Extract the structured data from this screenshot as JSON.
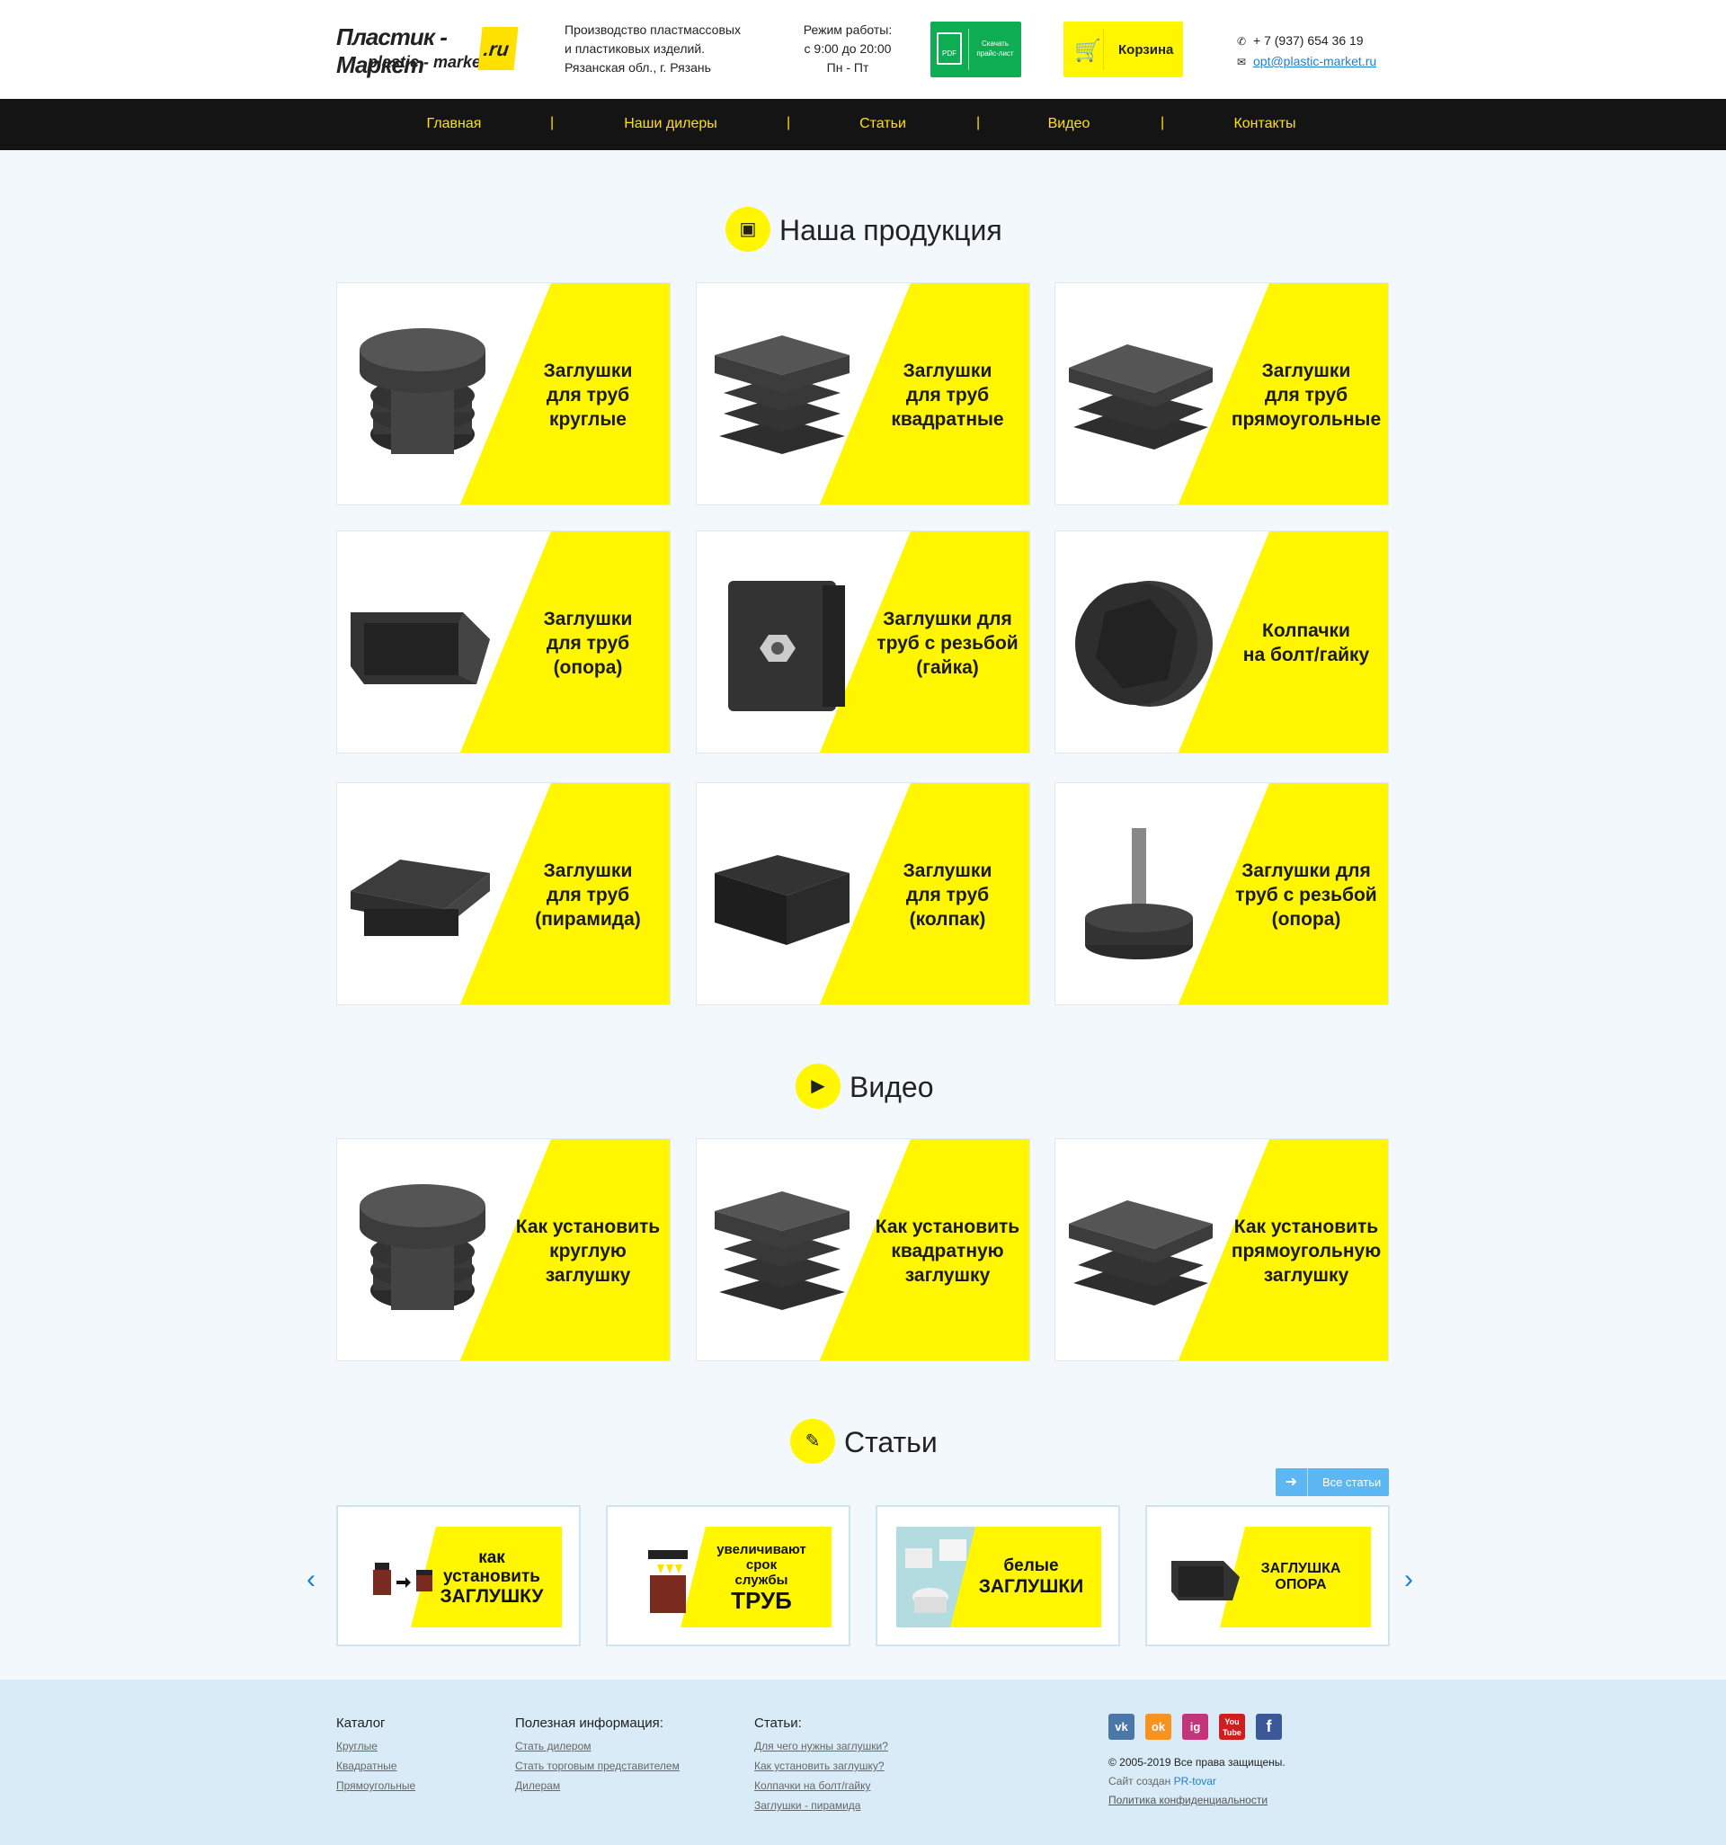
{
  "header": {
    "logo_line1": "Пластик - Маркет",
    "logo_line2": "plastic - market",
    "logo_ru": ".ru",
    "production": [
      "Производство пластмассовых",
      "и пластиковых изделий.",
      "Рязанская обл., г. Рязань"
    ],
    "hours": [
      "Режим работы:",
      "с 9:00 до 20:00",
      "Пн - Пт"
    ],
    "pdf_icon": "PDF",
    "pdf_button": [
      "Скачать",
      "прайс-лист"
    ],
    "cart_label": "Корзина",
    "phone": "+ 7 (937) 654 36 19",
    "email": "opt@plastic-market.ru"
  },
  "nav": [
    "Главная",
    "Наши дилеры",
    "Статьи",
    "Видео",
    "Контакты"
  ],
  "nav_separator": "|",
  "products": {
    "title": "Наша продукция",
    "items": [
      [
        "Заглушки",
        "для труб",
        "круглые"
      ],
      [
        "Заглушки",
        "для труб",
        "квадратные"
      ],
      [
        "Заглушки",
        "для труб",
        "прямоугольные"
      ],
      [
        "Заглушки",
        "для труб",
        "(опора)"
      ],
      [
        "Заглушки для",
        "труб с резьбой",
        "(гайка)"
      ],
      [
        "Колпачки",
        "на болт/гайку"
      ],
      [
        "Заглушки",
        "для труб",
        "(пирамида)"
      ],
      [
        "Заглушки",
        "для труб",
        "(колпак)"
      ],
      [
        "Заглушки для",
        "труб с резьбой",
        "(опора)"
      ]
    ]
  },
  "video": {
    "title": "Видео",
    "items": [
      [
        "Как установить",
        "круглую",
        "заглушку"
      ],
      [
        "Как установить",
        "квадратную",
        "заглушку"
      ],
      [
        "Как установить",
        "прямоугольную",
        "заглушку"
      ]
    ]
  },
  "articles": {
    "title": "Статьи",
    "all_button": "Все статьи",
    "items": [
      [
        "как",
        "установить",
        "ЗАГЛУШКУ"
      ],
      [
        "увеличивают",
        "срок",
        "службы",
        "ТРУБ"
      ],
      [
        "белые",
        "ЗАГЛУШКИ"
      ],
      [
        "ЗАГЛУШКА ОПОРА"
      ]
    ]
  },
  "footer": {
    "catalog": {
      "title": "Каталог",
      "links": [
        "Круглые",
        "Квадратные",
        "Прямоугольные"
      ]
    },
    "info": {
      "title": "Полезная информация:",
      "links": [
        "Стать дилером",
        "Стать торговым представителем",
        "Дилерам"
      ]
    },
    "articles": {
      "title": "Статьи:",
      "links": [
        "Для чего нужны заглушки?",
        "Как установить заглушку?",
        "Колпачки на болт/гайку",
        "Заглушки - пирамида"
      ]
    },
    "social": [
      {
        "label": "vk",
        "color": "#4a76a8"
      },
      {
        "label": "ok",
        "color": "#f7931e"
      },
      {
        "label": "ig",
        "color": "#c2357a"
      },
      {
        "label": "You Tube",
        "color": "#cc1f1f"
      },
      {
        "label": "f",
        "color": "#3b5998"
      }
    ],
    "copyright": "© 2005-2019 Все права защищены.",
    "created_prefix": "Сайт создан",
    "created_link": "PR-tovar",
    "policy": "Политика конфиденциальности"
  },
  "colors": {
    "accent_yellow": "#fff600",
    "nav_bg": "#141414",
    "nav_text": "#ffe100",
    "pdf_green": "#0fad53",
    "link_blue": "#1e7fcf"
  }
}
